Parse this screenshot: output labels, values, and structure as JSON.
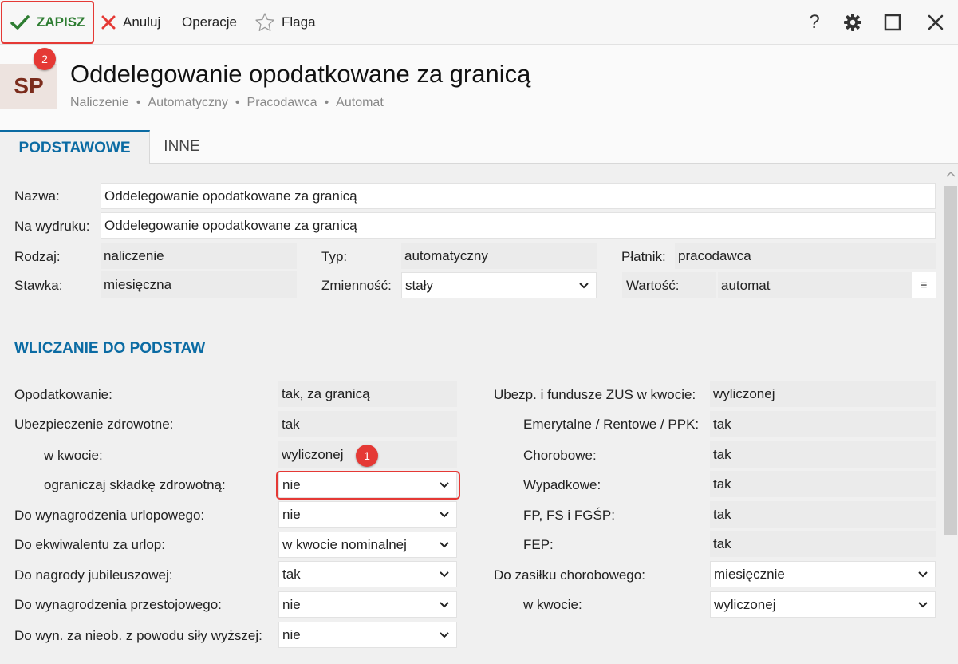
{
  "toolbar": {
    "save_label": "ZAPISZ",
    "cancel_label": "Anuluj",
    "operations_label": "Operacje",
    "flag_label": "Flaga",
    "help_label": "?",
    "save_badge": "2"
  },
  "header": {
    "avatar": "SP",
    "title": "Oddelegowanie opodatkowane za granicą",
    "breadcrumb": [
      "Naliczenie",
      "Automatyczny",
      "Pracodawca",
      "Automat"
    ]
  },
  "tabs": [
    "PODSTAWOWE",
    "INNE"
  ],
  "basic": {
    "nazwa_label": "Nazwa:",
    "nazwa_value": "Oddelegowanie opodatkowane za granicą",
    "wydruk_label": "Na wydruku:",
    "wydruk_value": "Oddelegowanie opodatkowane za granicą",
    "rodzaj_label": "Rodzaj:",
    "rodzaj_value": "naliczenie",
    "typ_label": "Typ:",
    "typ_value": "automatyczny",
    "platnik_label": "Płatnik:",
    "platnik_value": "pracodawca",
    "stawka_label": "Stawka:",
    "stawka_value": "miesięczna",
    "zmiennosc_label": "Zmienność:",
    "zmiennosc_value": "stały",
    "wartosc_label": "Wartość:",
    "wartosc_value": "automat",
    "wartosc_menu": "≡"
  },
  "section_title": "WLICZANIE DO PODSTAW",
  "left": {
    "opodatkowanie_label": "Opodatkowanie:",
    "opodatkowanie_value": "tak, za granicą",
    "zdrowotne_label": "Ubezpieczenie zdrowotne:",
    "zdrowotne_value": "tak",
    "wkwocie_label": "w kwocie:",
    "wkwocie_value": "wyliczonej",
    "wkwocie_badge": "1",
    "ogranicz_label": "ograniczaj składkę zdrowotną:",
    "ogranicz_value": "nie",
    "urlop_label": "Do wynagrodzenia urlopowego:",
    "urlop_value": "nie",
    "ekwiwalent_label": "Do ekwiwalentu za urlop:",
    "ekwiwalent_value": "w kwocie nominalnej",
    "jubileusz_label": "Do nagrody jubileuszowej:",
    "jubileusz_value": "tak",
    "przestoj_label": "Do wynagrodzenia przestojowego:",
    "przestoj_value": "nie",
    "sila_label": "Do wyn. za nieob. z powodu siły wyższej:",
    "sila_value": "nie"
  },
  "right": {
    "zus_label": "Ubezp. i fundusze ZUS w kwocie:",
    "zus_value": "wyliczonej",
    "emerytalne_label": "Emerytalne / Rentowe / PPK:",
    "emerytalne_value": "tak",
    "chorobowe_label": "Chorobowe:",
    "chorobowe_value": "tak",
    "wypadkowe_label": "Wypadkowe:",
    "wypadkowe_value": "tak",
    "fp_label": "FP, FS i FGŚP:",
    "fp_value": "tak",
    "fep_label": "FEP:",
    "fep_value": "tak",
    "zasilek_label": "Do zasiłku chorobowego:",
    "zasilek_value": "miesięcznie",
    "zasilek_kwota_label": "w kwocie:",
    "zasilek_kwota_value": "wyliczonej"
  },
  "colors": {
    "accent": "#0b6ba3",
    "save_green": "#2e7d32",
    "highlight_red": "#e53935",
    "avatar_text": "#7b2c1c"
  }
}
